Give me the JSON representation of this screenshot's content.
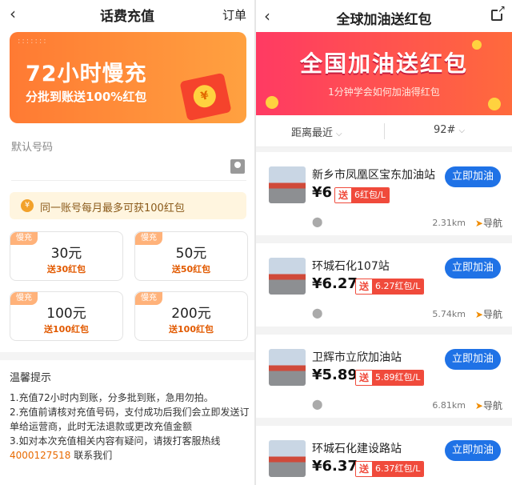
{
  "left": {
    "header": {
      "back_icon": "‹",
      "title": "话费充值",
      "order": "订单"
    },
    "promo": {
      "big": "72小时慢充",
      "sub": "分批到账送100%红包",
      "coin": "¥",
      "dots": ":::::::"
    },
    "default_label": "默认号码",
    "tip": "同一账号每月最多可获100红包",
    "cards": [
      {
        "tag": "慢充",
        "amount": "30元",
        "gift": "送30红包"
      },
      {
        "tag": "慢充",
        "amount": "50元",
        "gift": "送50红包"
      },
      {
        "tag": "慢充",
        "amount": "100元",
        "gift": "送100红包"
      },
      {
        "tag": "慢充",
        "amount": "200元",
        "gift": "送100红包"
      }
    ],
    "notes": {
      "heading": "温馨提示",
      "line1": "1.充值72小时内到账，分多批到账，急用勿拍。",
      "line2": "2.充值前请核对充值号码，支付成功后我们会立即发送订单给运营商，此时无法退款或更改充值金额",
      "line3": "3.如对本次充值相关内容有疑问，请拨打客服热线",
      "phone": "4000127518",
      "contact_us": "联系我们"
    }
  },
  "right": {
    "header": {
      "back_icon": "‹",
      "title": "全球加油送红包"
    },
    "banner": {
      "big": "全国加油送红包",
      "sub": "1分钟学会如何加油得红包"
    },
    "filters": {
      "distance": "距离最近",
      "fuel": "92#",
      "chevron": "⌵"
    },
    "stations": [
      {
        "name": "新乡市凤凰区宝东加油站",
        "price": "¥6",
        "send": "送",
        "bonus": "6红包/L",
        "button": "立即加油",
        "distance": "2.31km",
        "nav": "导航"
      },
      {
        "name": "环城石化107站",
        "price": "¥6.27",
        "send": "送",
        "bonus": "6.27红包/L",
        "button": "立即加油",
        "distance": "5.74km",
        "nav": "导航"
      },
      {
        "name": "卫辉市立欣加油站",
        "price": "¥5.89",
        "send": "送",
        "bonus": "5.89红包/L",
        "button": "立即加油",
        "distance": "6.81km",
        "nav": "导航"
      },
      {
        "name": "环城石化建设路站",
        "price": "¥6.37",
        "send": "送",
        "bonus": "6.37红包/L",
        "button": "立即加油",
        "distance": "",
        "nav": ""
      }
    ],
    "pin_icon": "⬤",
    "nav_arrow": "➤"
  }
}
